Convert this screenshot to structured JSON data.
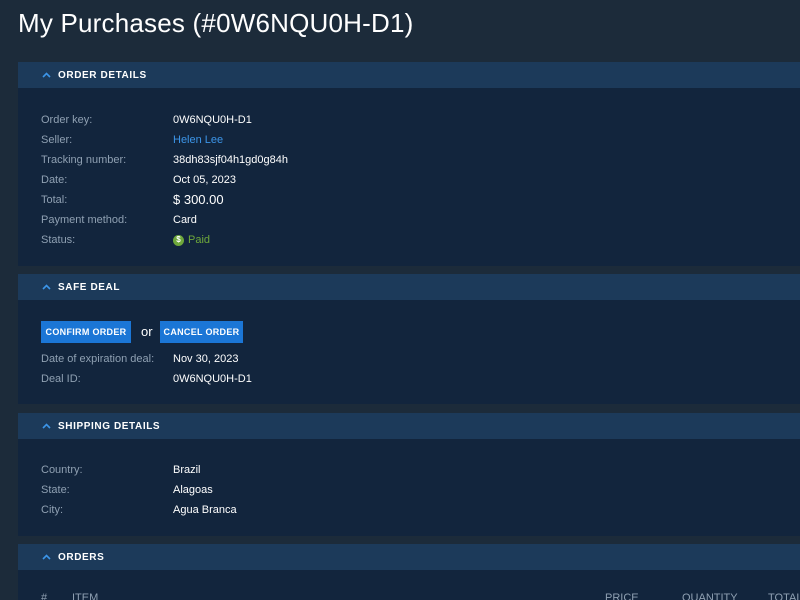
{
  "page": {
    "title": "My Purchases (#0W6NQU0H-D1)"
  },
  "order_details": {
    "header": "ORDER DETAILS",
    "fields": [
      {
        "label": "Order key:",
        "value": "0W6NQU0H-D1"
      },
      {
        "label": "Seller:",
        "value": "Helen Lee"
      },
      {
        "label": "Tracking number:",
        "value": "38dh83sjf04h1gd0g84h"
      },
      {
        "label": "Date:",
        "value": "Oct 05, 2023"
      },
      {
        "label": "Total:",
        "value": "$ 300.00"
      },
      {
        "label": "Payment method:",
        "value": "Card"
      }
    ],
    "status": {
      "label": "Status:",
      "icon": "dollar-icon",
      "value": "Paid",
      "color": "#6ea83b"
    }
  },
  "safe_deal": {
    "header": "SAFE DEAL",
    "confirm_label": "CONFIRM ORDER",
    "or_text": "or",
    "cancel_label": "CANCEL ORDER",
    "fields": [
      {
        "label": "Date of expiration deal:",
        "value": "Nov 30, 2023"
      },
      {
        "label": "Deal ID:",
        "value": "0W6NQU0H-D1"
      }
    ]
  },
  "shipping_details": {
    "header": "SHIPPING DETAILS",
    "fields": [
      {
        "label": "Country:",
        "value": "Brazil"
      },
      {
        "label": "State:",
        "value": "Alagoas"
      },
      {
        "label": "City:",
        "value": "Agua Branca"
      }
    ]
  },
  "orders": {
    "header": "ORDERS",
    "columns": [
      "#",
      "ITEM",
      "PRICE",
      "QUANTITY",
      "TOTAL"
    ]
  },
  "colors": {
    "background": "#1c2b3a",
    "panel": "#12253d",
    "panel_header": "#1c3a5a",
    "accent": "#1b76d6",
    "link": "#3c95e8"
  }
}
